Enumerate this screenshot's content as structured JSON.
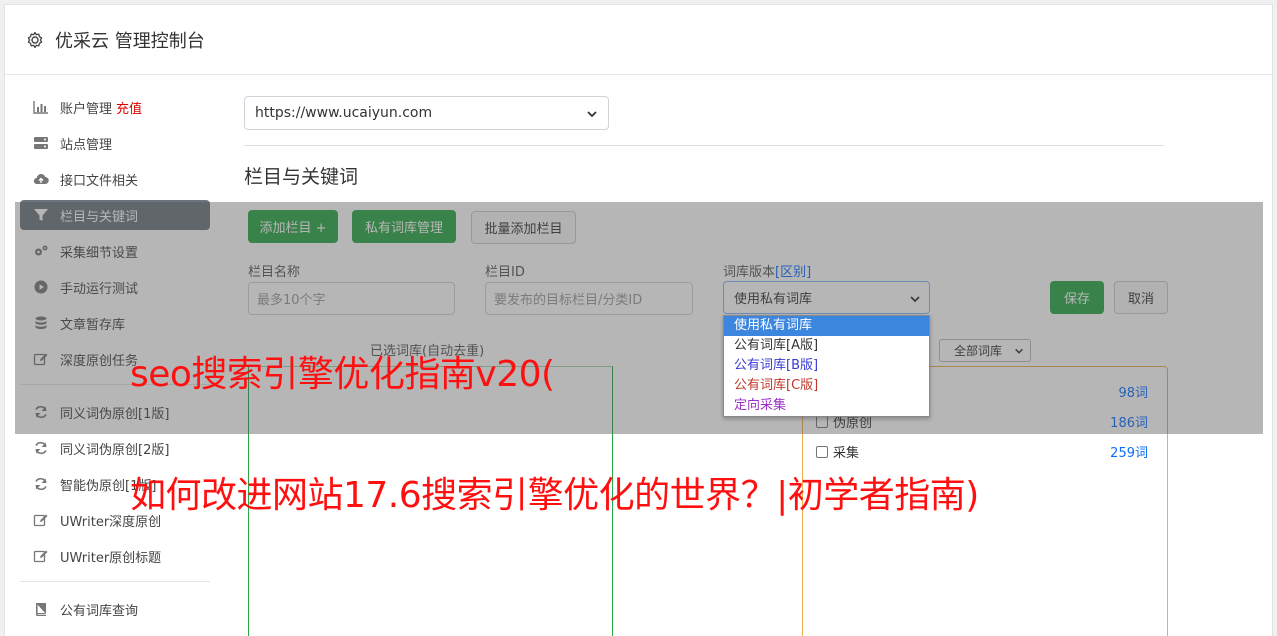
{
  "header": {
    "title": "优采云 管理控制台",
    "icon": "gear-icon"
  },
  "sidebar": {
    "items": [
      {
        "label": "账户管理",
        "badge": "充值",
        "icon": "bar-chart-icon"
      },
      {
        "label": "站点管理",
        "icon": "server-icon"
      },
      {
        "label": "接口文件相关",
        "icon": "cloud-upload-icon"
      },
      {
        "label": "栏目与关键词",
        "icon": "filter-icon",
        "active": true
      },
      {
        "label": "采集细节设置",
        "icon": "cogs-icon"
      },
      {
        "label": "手动运行测试",
        "icon": "play-icon"
      },
      {
        "label": "文章暂存库",
        "icon": "database-icon"
      },
      {
        "label": "深度原创任务",
        "icon": "edit-icon"
      },
      {
        "label": "同义词伪原创[1版]",
        "icon": "refresh-icon"
      },
      {
        "label": "同义词伪原创[2版]",
        "icon": "refresh-icon"
      },
      {
        "label": "智能伪原创[1版]",
        "icon": "refresh-icon"
      },
      {
        "label": "UWriter深度原创",
        "icon": "edit-icon"
      },
      {
        "label": "UWriter原创标题",
        "icon": "edit-icon"
      },
      {
        "label": "公有词库查询",
        "icon": "book-icon"
      }
    ]
  },
  "main": {
    "site_select_value": "https://www.ucaiyun.com",
    "section_title": "栏目与关键词",
    "buttons": {
      "add_column": "添加栏目 +",
      "private_lib": "私有词库管理",
      "batch_add": "批量添加栏目",
      "save": "保存",
      "cancel": "取消"
    },
    "fields": {
      "name_label": "栏目名称",
      "name_placeholder": "最多10个字",
      "id_label": "栏目ID",
      "id_placeholder": "要发布的目标栏目/分类ID",
      "version_label": "词库版本",
      "version_link": "[区别]",
      "version_value": "使用私有词库"
    },
    "version_options": [
      {
        "label": "使用私有词库",
        "color": "#ffffff"
      },
      {
        "label": "公有词库[A版]",
        "color": "#333333"
      },
      {
        "label": "公有词库[B版]",
        "color": "#3a3acf"
      },
      {
        "label": "公有词库[C版]",
        "color": "#c0392b"
      },
      {
        "label": "定向采集",
        "color": "#9b30c8"
      }
    ],
    "selected_caption": "已选词库(自动去重)",
    "filter_value": "全部词库",
    "library_rows": [
      {
        "label": "",
        "count": "98词"
      },
      {
        "label": "伪原创",
        "count": "186词"
      },
      {
        "label": "采集",
        "count": "259词"
      }
    ]
  },
  "watermark": {
    "line1": "seo搜索引擎优化指南v20(",
    "line2": "如何改进网站17.6搜索引擎优化的世界？|初学者指南)"
  }
}
